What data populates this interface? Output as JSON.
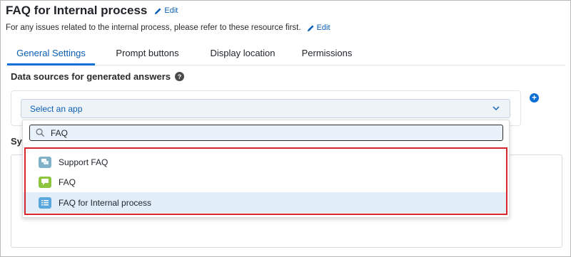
{
  "header": {
    "title": "FAQ for Internal process",
    "title_edit_label": "Edit",
    "description": "For any issues related to the internal process, please refer to these resource first.",
    "description_edit_label": "Edit"
  },
  "tabs": [
    {
      "label": "General Settings",
      "active": true
    },
    {
      "label": "Prompt buttons",
      "active": false
    },
    {
      "label": "Display location",
      "active": false
    },
    {
      "label": "Permissions",
      "active": false
    }
  ],
  "data_sources": {
    "label": "Data sources for generated answers",
    "help_icon": "?",
    "select_placeholder": "Select an app",
    "add_icon": "+"
  },
  "partially_hidden_label": "Sy",
  "dropdown": {
    "search_value": "FAQ",
    "options": [
      {
        "label": "Support FAQ",
        "icon": "chat-bubbles-icon",
        "icon_color": "#7fb2c8",
        "selected": false
      },
      {
        "label": "FAQ",
        "icon": "chat-bubble-icon",
        "icon_color": "#8dc53e",
        "selected": false
      },
      {
        "label": "FAQ for Internal process",
        "icon": "list-icon",
        "icon_color": "#5aa7de",
        "selected": true
      }
    ]
  },
  "colors": {
    "accent": "#0b6fd3",
    "link": "#0b5fb3",
    "highlight_border": "#d7262e",
    "selected_row": "#e1eef9"
  }
}
